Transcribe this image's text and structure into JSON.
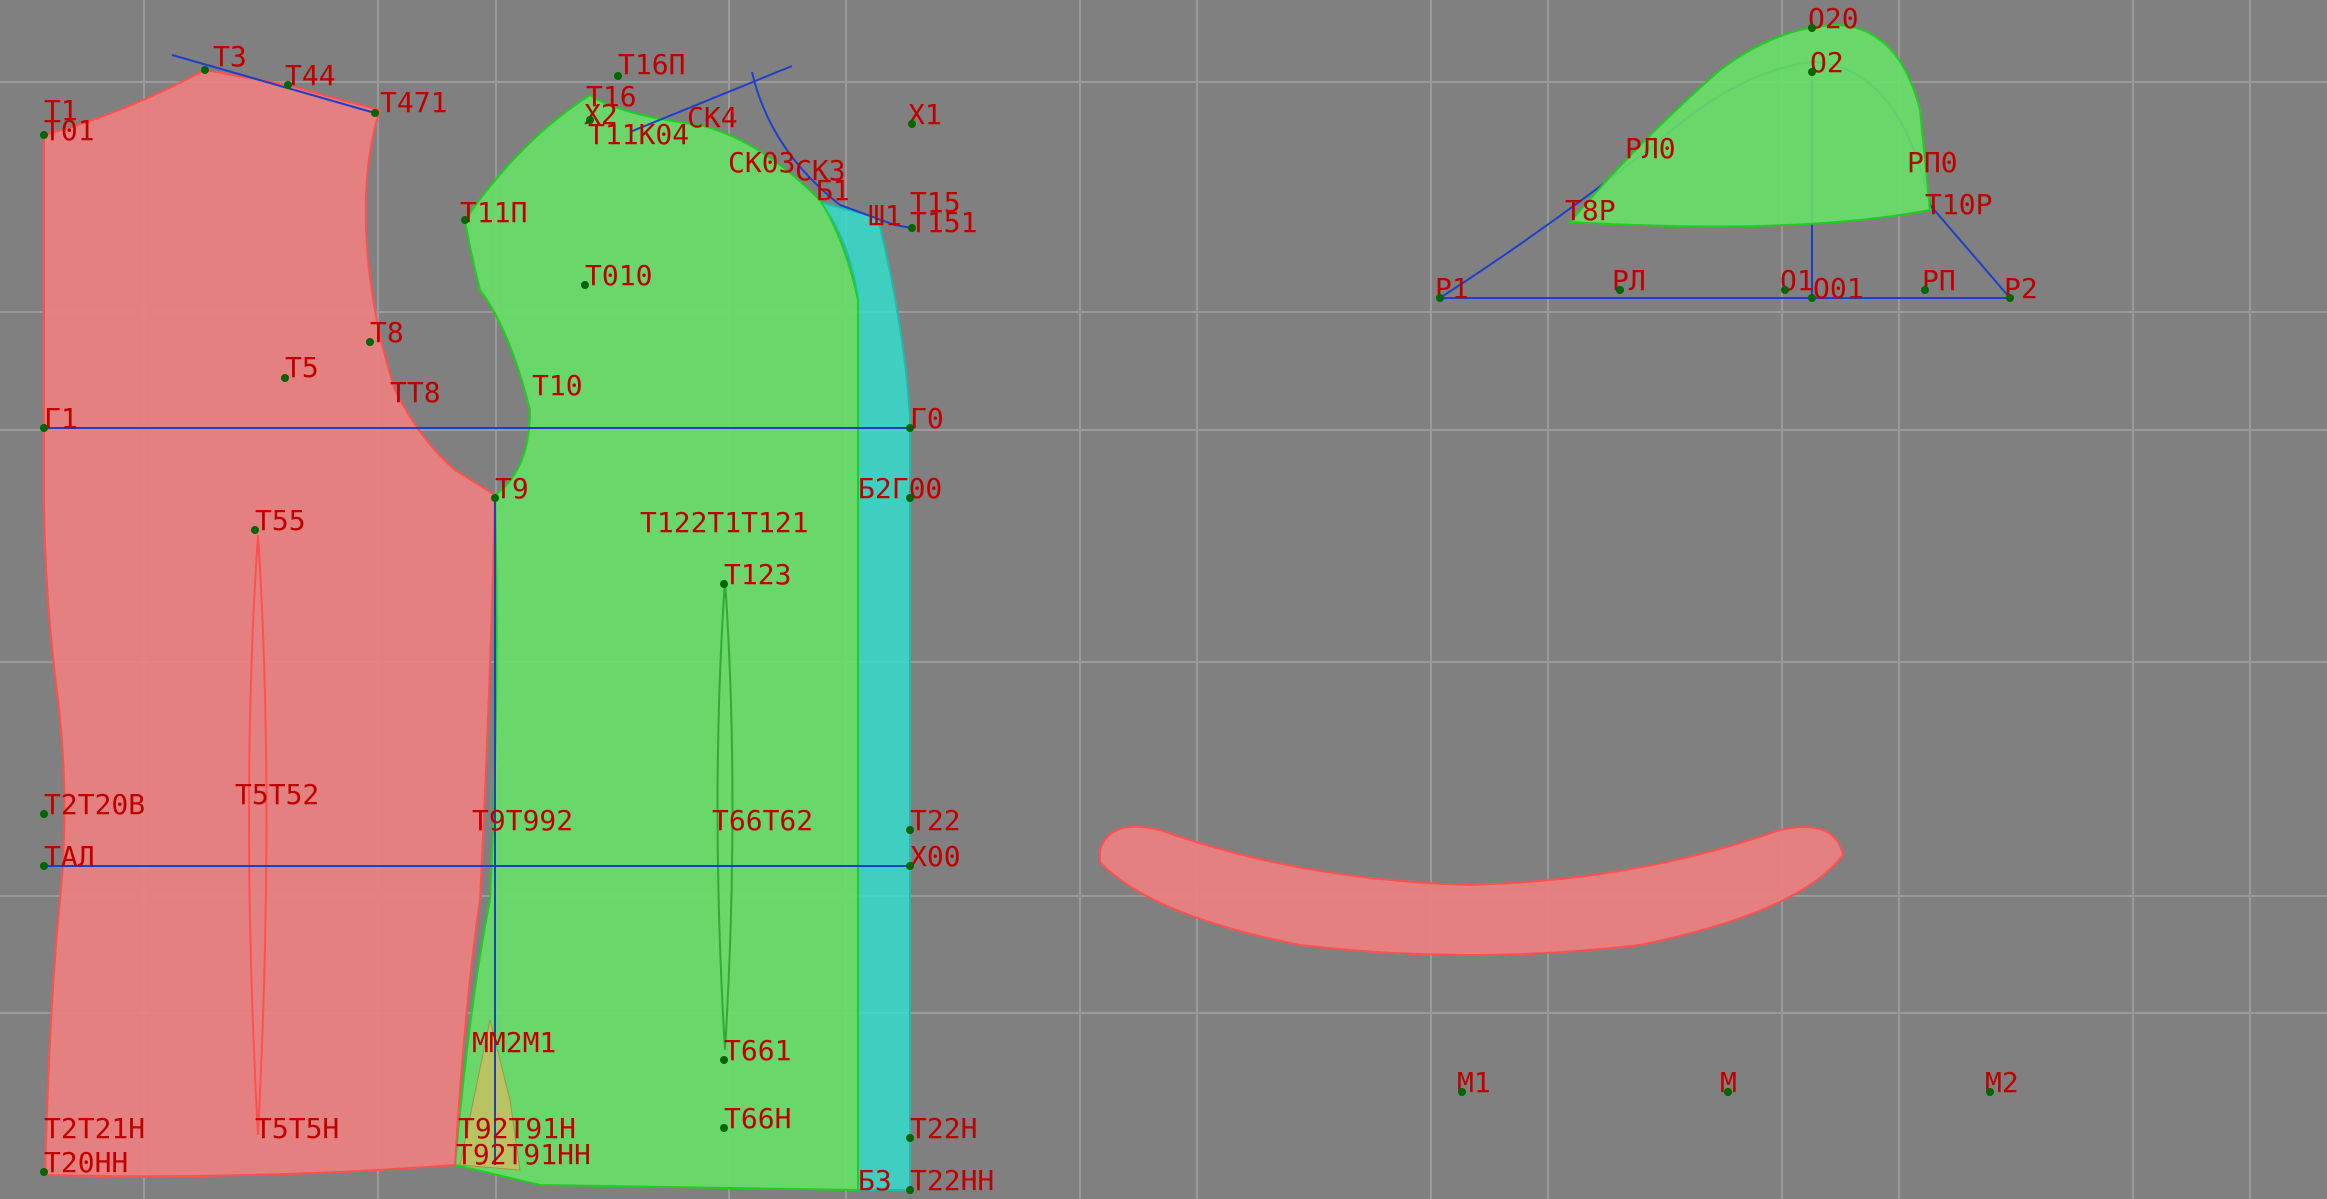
{
  "colors": {
    "background": "#808080",
    "grid": "#9a9a9a",
    "label": "#c00000",
    "back_piece_fill": "#f08080",
    "front_piece_fill": "#66e066",
    "facing_fill": "#33ddcc",
    "sleeve_fill": "#66e066",
    "collar_fill": "#f08080",
    "construction_line": "#1f3fc8",
    "point": "#006600"
  },
  "pieces": {
    "back": "back-panel",
    "front": "front-panel",
    "facing": "facing-strip",
    "sleeve_cap": "sleeve-cap",
    "collar": "collar-piece"
  },
  "labels": {
    "t1": "Т1",
    "t01": "Т01",
    "t3": "Т3",
    "t44": "Т44",
    "t471": "Т471",
    "t16p": "Т16П",
    "t16": "Т16",
    "x2": "Х2",
    "t11k04": "Т11К04",
    "sk4": "СК4",
    "sk03": "СК03",
    "sk3": "СК3",
    "b1": "Б1",
    "x1": "Х1",
    "sh1": "Ш1",
    "t15": "Т15",
    "t151": "Т151",
    "t11p": "Т11П",
    "t010": "Т010",
    "t8": "Т8",
    "t5": "Т5",
    "tt8": "ТТ8",
    "t10": "Т10",
    "g1": "Г1",
    "g0": "Г0",
    "t9": "Т9",
    "b2g00": "Б2Г00",
    "t55": "Т55",
    "t122": "Т122Т1Т121",
    "t123": "Т123",
    "t20": "Т2Т20В",
    "t51": "Т5Т52",
    "t9992": "Т9Т992",
    "t662": "Т66Т62",
    "t22": "Т22",
    "tal": "ТАЛ",
    "x00": "Х00",
    "mm2": "ММ2М1",
    "t661": "Т661",
    "t21n": "Т2Т21Н",
    "t5n": "Т5Т5Н",
    "t92n": "Т92Т91Н",
    "t66n": "Т66Н",
    "t22n": "Т22Н",
    "t20nn": "Т20НН",
    "t92nn": "Т92Т91НН",
    "b3": "Б3",
    "t22nn": "Т22НН",
    "o20": "О20",
    "o2": "О2",
    "rl0": "РЛ0",
    "rp0": "РП0",
    "t8r": "Т8Р",
    "t10r": "Т10Р",
    "r1": "Р1",
    "rl": "РЛ",
    "o1": "О1",
    "o01": "О01",
    "rp": "РП",
    "r2": "Р2",
    "m1": "М1",
    "m": "М",
    "m2": "М2"
  }
}
